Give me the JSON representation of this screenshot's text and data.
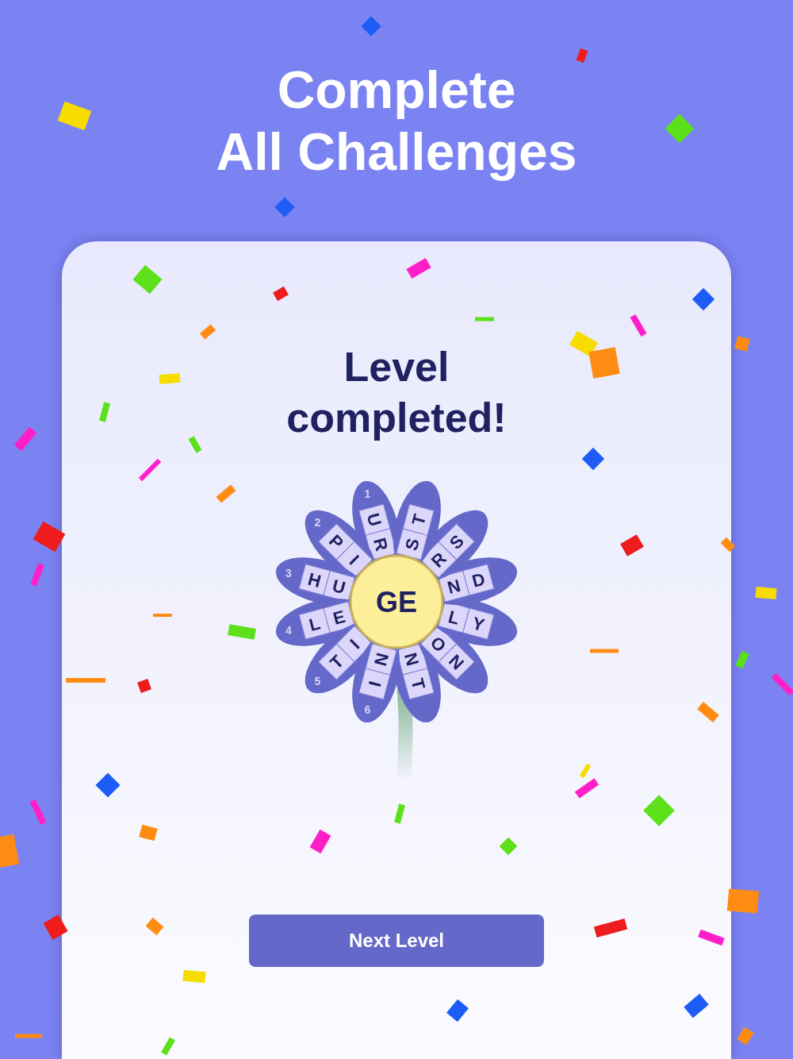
{
  "headline": [
    "Complete",
    "All Challenges"
  ],
  "card": {
    "title": [
      "Level",
      "completed!"
    ],
    "flower": {
      "center": "GE",
      "words": [
        {
          "number": "1",
          "left": [
            "U",
            "R"
          ],
          "right": [
            "N",
            "T"
          ]
        },
        {
          "number": "2",
          "left": [
            "P",
            "I"
          ],
          "right": [
            "O",
            "N"
          ]
        },
        {
          "number": "3",
          "left": [
            "H",
            "U"
          ],
          "right": [
            "L",
            "Y"
          ]
        },
        {
          "number": "4",
          "left": [
            "L",
            "E"
          ],
          "right": [
            "N",
            "D"
          ]
        },
        {
          "number": "5",
          "left": [
            "T",
            "I"
          ],
          "right": [
            "R",
            "S"
          ]
        },
        {
          "number": "6",
          "left": [
            "I",
            "N"
          ],
          "right": [
            "S",
            "T"
          ]
        }
      ]
    },
    "button": "Next Level"
  }
}
